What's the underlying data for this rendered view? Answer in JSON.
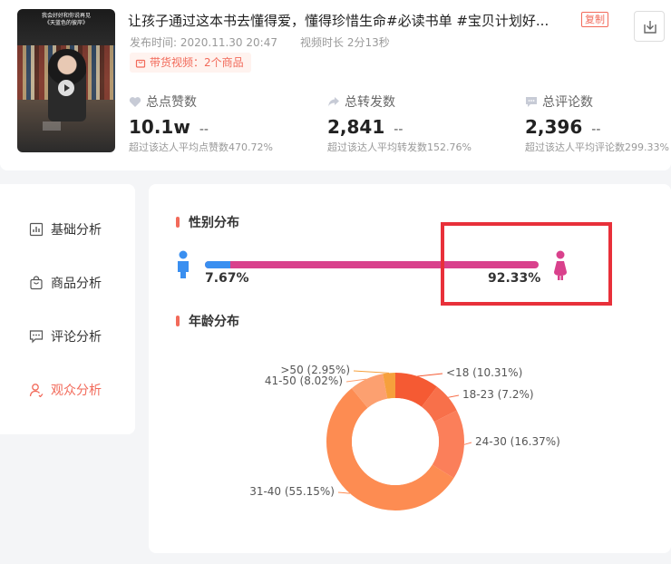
{
  "video": {
    "thumb_caption": "我会好好和你说再见\n《天蓝色的彼岸》",
    "title": "让孩子通过这本书去懂得爱，懂得珍惜生命#必读书单 #宝贝计划好...",
    "copy_label": "复制",
    "publish_time": "发布时间:  2020.11.30 20:47",
    "duration": "视频时长  2分13秒",
    "goods_tag": "带货视频：2个商品"
  },
  "stats": [
    {
      "label": "总点赞数",
      "value": "10.1w",
      "dash": "--",
      "sub": "超过该达人平均点赞数470.72%"
    },
    {
      "label": "总转发数",
      "value": "2,841",
      "dash": "--",
      "sub": "超过该达人平均转发数152.76%"
    },
    {
      "label": "总评论数",
      "value": "2,396",
      "dash": "--",
      "sub": "超过该达人平均评论数299.33%"
    }
  ],
  "sidebar": {
    "items": [
      {
        "label": "基础分析",
        "icon": "bar-chart-icon"
      },
      {
        "label": "商品分析",
        "icon": "shopping-bag-icon"
      },
      {
        "label": "评论分析",
        "icon": "comment-icon"
      },
      {
        "label": "观众分析",
        "icon": "user-icon",
        "active": true
      }
    ]
  },
  "gender": {
    "title": "性别分布",
    "male_pct": "7.67%",
    "female_pct": "92.33%",
    "male_value": 7.67,
    "colors": {
      "male": "#3a8ff0",
      "female": "#d9418c"
    }
  },
  "age": {
    "title": "年龄分布"
  },
  "chart_data": {
    "type": "pie",
    "categories": [
      "<18",
      "18-23",
      "24-30",
      "31-40",
      "41-50",
      ">50"
    ],
    "values": [
      10.31,
      7.2,
      16.37,
      55.15,
      8.02,
      2.95
    ],
    "labels": [
      "<18 (10.31%)",
      "18-23 (7.2%)",
      "24-30 (16.37%)",
      "31-40 (55.15%)",
      "41-50 (8.02%)",
      ">50 (2.95%)"
    ],
    "colors": [
      "#f55a33",
      "#f8704a",
      "#fb7f5a",
      "#fd8c52",
      "#fca070",
      "#f6a03c"
    ]
  }
}
